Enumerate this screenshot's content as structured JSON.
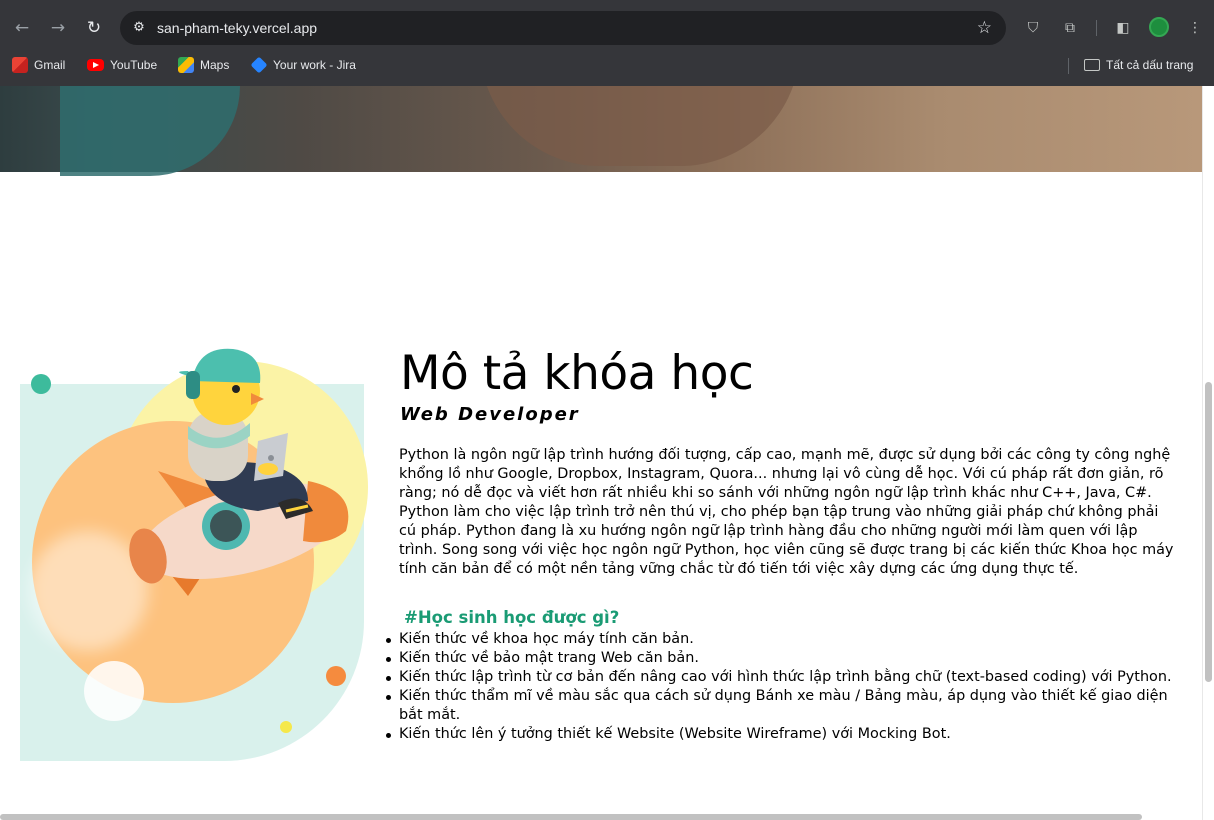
{
  "browser": {
    "url": "san-pham-teky.vercel.app",
    "bookmarks": [
      {
        "label": "Gmail",
        "icon": "gmail-icon"
      },
      {
        "label": "YouTube",
        "icon": "youtube-icon"
      },
      {
        "label": "Maps",
        "icon": "maps-icon"
      },
      {
        "label": "Your work - Jira",
        "icon": "jira-icon"
      }
    ],
    "all_bookmarks_label": "Tất cả dấu trang"
  },
  "course": {
    "title": "Mô tả khóa học",
    "subtitle": "Web Developer",
    "description": "Python là ngôn ngữ lập trình hướng đối tượng, cấp cao, mạnh mẽ, được sử dụng bởi các công ty công nghệ khổng lồ như Google, Dropbox, Instagram, Quora... nhưng lại vô cùng dễ học. Với cú pháp rất đơn giản, rõ ràng; nó dễ đọc và viết hơn rất nhiều khi so sánh với những ngôn ngữ lập trình khác như C++, Java, C#. Python làm cho việc lập trình trở nên thú vị, cho phép bạn tập trung vào những giải pháp chứ không phải cú pháp. Python đang là xu hướng ngôn ngữ lập trình hàng đầu cho những người mới làm quen với lập trình. Song song với việc học ngôn ngữ Python, học viên cũng sẽ được trang bị các kiến thức Khoa học máy tính căn bản để có một nền tảng vững chắc từ đó tiến tới việc xây dựng các ứng dụng thực tế.",
    "goals_title": "#Học sinh học được gì?",
    "goals": [
      "Kiến thức về khoa học máy tính căn bản.",
      "Kiến thức về bảo mật trang Web căn bản.",
      "Kiến thức lập trình từ cơ bản đến nâng cao với hình thức lập trình bằng chữ (text-based coding) với Python.",
      "Kiến thức thẩm mĩ về màu sắc qua cách sử dụng Bánh xe màu / Bảng màu, áp dụng vào thiết kế giao diện bắt mắt.",
      "Kiến thức lên ý tưởng thiết kế Website (Website Wireframe) với Mocking Bot."
    ]
  },
  "colors": {
    "accent_green": "#1a9b74",
    "illustration_mint": "#d9f1ec",
    "illustration_orange": "#fdc27e",
    "illustration_yellow": "#fbf3a6"
  }
}
